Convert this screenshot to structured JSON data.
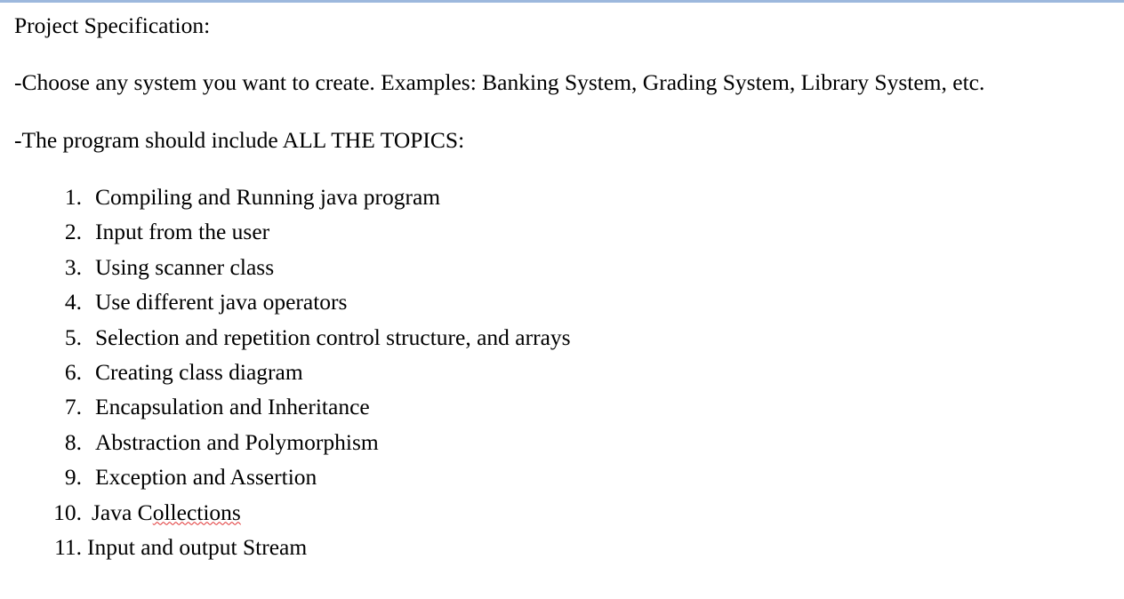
{
  "document": {
    "heading": "Project Specification:",
    "paragraphs": [
      {
        "id": "choose-system",
        "text": "-Choose any system you want to create. Examples: Banking System, Grading System, Library System, etc."
      },
      {
        "id": "all-topics",
        "text": "-The program should include  ALL THE TOPICS:"
      }
    ],
    "topics_list": [
      {
        "number": "1.",
        "text": "Compiling and Running java program"
      },
      {
        "number": "2.",
        "text": "Input from the user"
      },
      {
        "number": "3.",
        "text": "Using scanner class"
      },
      {
        "number": "4.",
        "text": "Use different java operators"
      },
      {
        "number": "5.",
        "text": "Selection and repetition control structure, and arrays"
      },
      {
        "number": "6.",
        "text": "Creating class diagram"
      },
      {
        "number": "7.",
        "text": "Encapsulation and Inheritance"
      },
      {
        "number": "8.",
        "text": "Abstraction and Polymorphism"
      },
      {
        "number": "9.",
        "text": "Exception and Assertion"
      },
      {
        "number": "10.",
        "text": "Java Collections",
        "spellcheck_prefix": "Java C",
        "spellcheck_flagged": "ollections"
      },
      {
        "number": "11.",
        "text": "Input and output Stream"
      }
    ],
    "colors": {
      "top_rule": "#9db8dd",
      "text": "#000000",
      "spellcheck_underline": "#e03131",
      "background": "#ffffff"
    }
  }
}
